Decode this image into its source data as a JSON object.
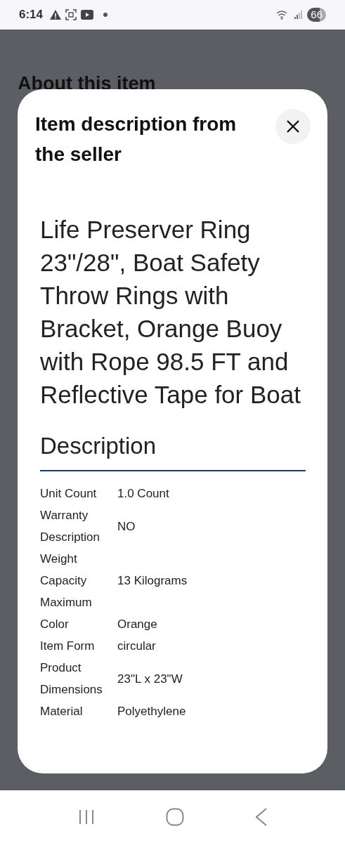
{
  "status_bar": {
    "time": "6:14",
    "battery": "66"
  },
  "background": {
    "heading": "About this item"
  },
  "dialog": {
    "title": "Item description from the seller",
    "product_title": "Life Preserver Ring 23\"/28\", Boat Safety Throw Rings with Bracket, Orange Buoy with Rope 98.5 FT and Reflective Tape for Boat",
    "section_heading": "Description",
    "specs": [
      {
        "label": "Unit Count",
        "value": "1.0 Count"
      },
      {
        "label": "Warranty Description",
        "value": "NO"
      },
      {
        "label": "Weight Capacity Maximum",
        "value": "13 Kilograms"
      },
      {
        "label": "Color",
        "value": "Orange"
      },
      {
        "label": "Item Form",
        "value": "circular"
      },
      {
        "label": "Product Dimensions",
        "value": "23\"L x 23\"W"
      },
      {
        "label": "Material",
        "value": "Polyethylene"
      }
    ]
  }
}
